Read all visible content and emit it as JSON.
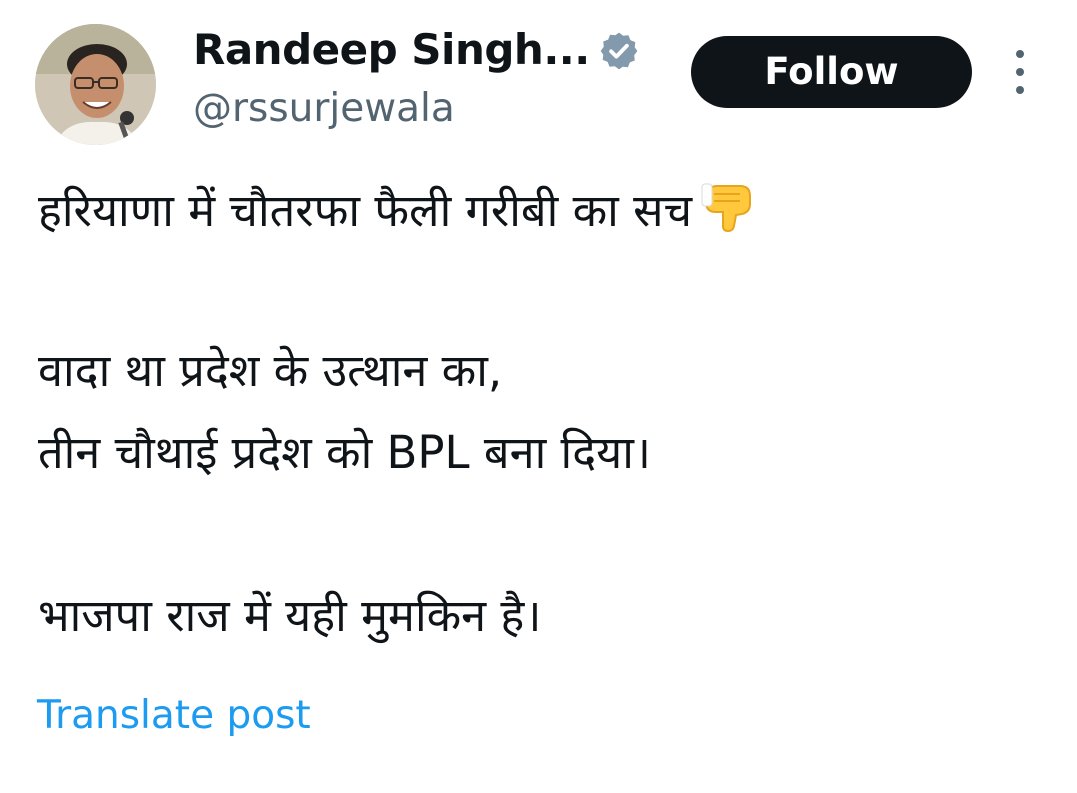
{
  "author": {
    "display_name": "Randeep Singh...",
    "handle": "@rssurjewala",
    "verified": true,
    "verified_color": "#829aab"
  },
  "actions": {
    "follow_label": "Follow",
    "more_icon": "more-vertical-icon"
  },
  "post": {
    "lines": [
      "हरियाणा में चौतरफा फैली गरीबी का सच",
      "वादा था प्रदेश के उत्थान का,",
      "तीन चौथाई प्रदेश को BPL बना दिया।",
      "भाजपा राज में यही मुमकिन है।"
    ],
    "emoji": "backhand-index-pointing-down-icon"
  },
  "translate_label": "Translate post",
  "colors": {
    "text_primary": "#0f1419",
    "text_secondary": "#536471",
    "link": "#1d9bf0",
    "button_bg": "#0f1419",
    "button_text": "#ffffff"
  }
}
